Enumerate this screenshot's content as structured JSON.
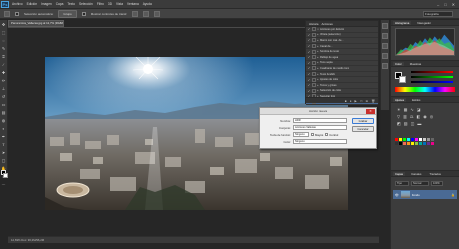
{
  "app": {
    "logo": "Ps",
    "menu": [
      "Archivo",
      "Edición",
      "Imagen",
      "Capa",
      "Texto",
      "Selección",
      "Filtro",
      "3D",
      "Vista",
      "Ventana",
      "Ayuda"
    ],
    "window_controls": {
      "minimize": "–",
      "maximize": "□",
      "close": "✕"
    }
  },
  "options": {
    "auto_select_label": "Selección automática:",
    "auto_select_value": "Grupo",
    "show_transform_label": "Mostrar controles de transf.",
    "workspace": "Fotografía"
  },
  "document": {
    "tab_title": "Panoramica_Vallecas.jpg al 12,7% (RGB/8*) ×",
    "status": "12,69%     Doc: 96,2M/96,2M"
  },
  "actions_panel": {
    "tabs": [
      "Historia",
      "Acciones"
    ],
    "items": [
      {
        "label": "Acciones por defecto",
        "expanded": true,
        "selected": false
      },
      {
        "label": "Viñeta (selección)",
        "expanded": false,
        "selected": false
      },
      {
        "label": "Marco con mat. de...",
        "expanded": false,
        "selected": false
      },
      {
        "label": "Canal de...",
        "expanded": false,
        "selected": false
      },
      {
        "label": "Sombra de texto",
        "expanded": false,
        "selected": false
      },
      {
        "label": "Reflejo de agua",
        "expanded": false,
        "selected": false
      },
      {
        "label": "Tono sepia",
        "expanded": false,
        "selected": false
      },
      {
        "label": "Cuadrante de medio tono",
        "expanded": false,
        "selected": false
      },
      {
        "label": "Texto fundido",
        "expanded": false,
        "selected": false
      },
      {
        "label": "Ajustes de color",
        "expanded": false,
        "selected": false
      },
      {
        "label": "Tonos y grises",
        "expanded": false,
        "selected": false
      },
      {
        "label": "Selección de color",
        "expanded": false,
        "selected": false
      },
      {
        "label": "Suavizar foto",
        "expanded": false,
        "selected": false
      },
      {
        "label": "Acciones Vallecas",
        "expanded": true,
        "selected": true
      }
    ]
  },
  "right_panels": {
    "histogram_tabs": [
      "Histograma",
      "Navegador"
    ],
    "color_tabs": [
      "Color",
      "Muestras"
    ],
    "adjust_tabs": [
      "Ajustes",
      "Estilos"
    ],
    "layers_tabs": [
      "Capas",
      "Canales",
      "Trazados"
    ],
    "layer_kind": "Tipo",
    "layer_blend": "Normal",
    "layer_opacity": "100%",
    "layer_name": "Fondo"
  },
  "dialog": {
    "title": "Acción nueva",
    "name_label": "Nombre:",
    "name_value": "HDR",
    "set_label": "Conjunto:",
    "set_value": "Acciones Vallecas",
    "function_key_label": "Tecla de función:",
    "function_key_value": "Ninguno",
    "shift_label": "Mayús",
    "control_label": "Control",
    "color_label": "Color:",
    "color_value": "Ninguno",
    "record_button": "Grabar",
    "cancel_button": "Cancelar"
  }
}
